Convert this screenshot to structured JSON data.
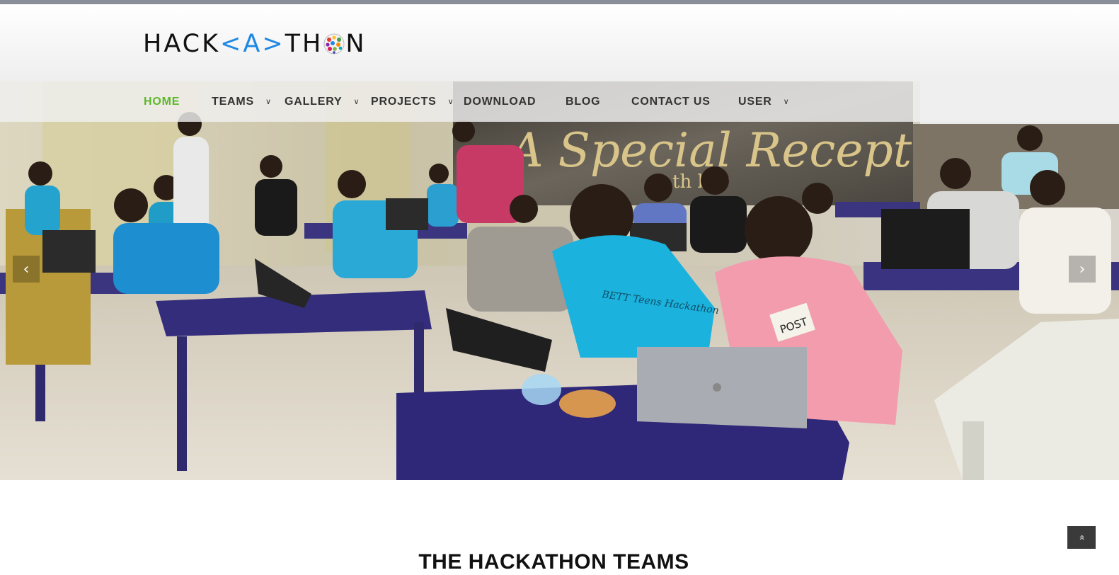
{
  "logo": {
    "part1": "HACK",
    "bracket_open": "<",
    "letter_a": "A",
    "bracket_close": ">",
    "part2": "TH",
    "part3": "N",
    "accent_color": "#1e88e5"
  },
  "nav": {
    "items": [
      {
        "label": "HOME",
        "active": true
      },
      {
        "label": "TEAMS",
        "dropdown": true
      },
      {
        "label": "GALLERY",
        "dropdown": true
      },
      {
        "label": "PROJECTS",
        "dropdown": true
      },
      {
        "label": "DOWNLOAD"
      },
      {
        "label": "BLOG"
      },
      {
        "label": "CONTACT US"
      },
      {
        "label": "USER",
        "dropdown": true
      }
    ],
    "active_color": "#5cb829",
    "chevron_icon": "chevron-down-icon"
  },
  "hero": {
    "banner_text": "A Special Reception",
    "banner_sub": "th  ber",
    "badge_text": "POST",
    "shirt_text": "BETT Teens Hackathon",
    "prev_icon": "‹",
    "next_icon": "›"
  },
  "section": {
    "title": "THE HACKATHON TEAMS"
  },
  "scroll_top": {
    "icon": "double-chevron-up-icon",
    "glyph": "«"
  }
}
